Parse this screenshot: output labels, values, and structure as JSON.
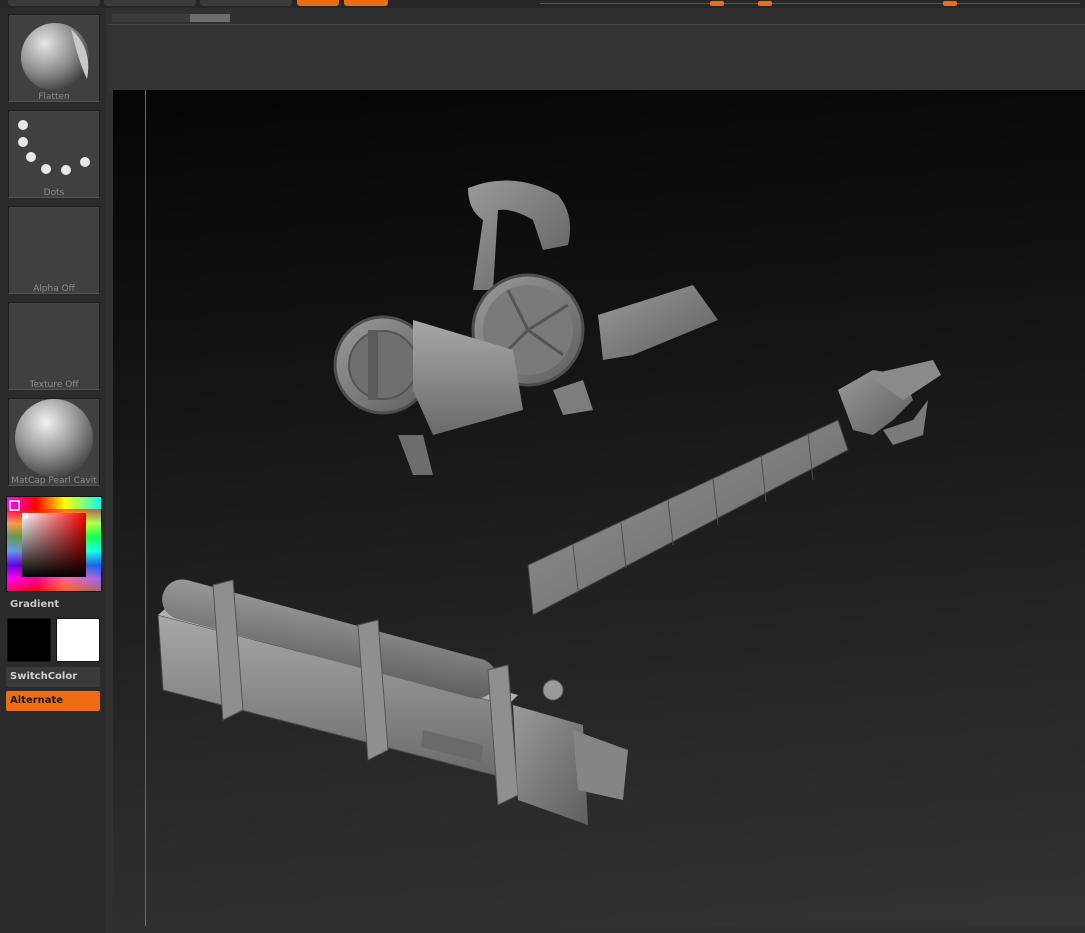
{
  "palette": {
    "brush_label": "Flatten",
    "stroke_label": "Dots",
    "alpha_label": "Alpha  Off",
    "texture_label": "Texture  Off",
    "material_label": "MatCap  Pearl  Cavit",
    "gradient_label": "Gradient",
    "switchcolor_label": "SwitchColor",
    "alternate_label": "Alternate"
  },
  "colors": {
    "accent": "#ef6c14",
    "main_color": "#000000",
    "secondary_color": "#ffffff"
  }
}
